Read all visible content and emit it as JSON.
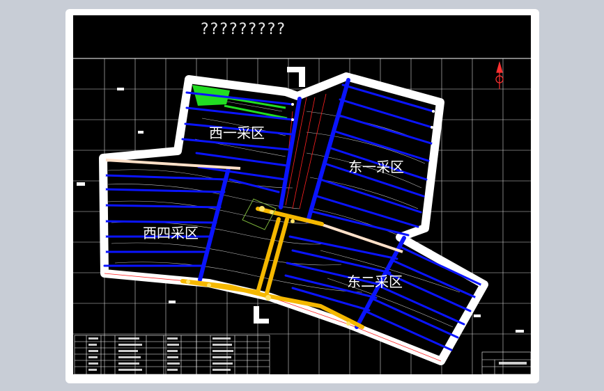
{
  "title": "?????????",
  "zones": {
    "west_one": "西一采区",
    "east_one": "东一采区",
    "west_four": "西四采区",
    "east_two": "东二采区"
  },
  "north_arrow_icon": "north-arrow-icon",
  "colors": {
    "background": "#000000",
    "frame": "#ffffff",
    "haul_road": "#0a14ff",
    "main_roadway": "#f5b800",
    "working_face": "#22dd22",
    "fault_line": "#ff2020",
    "contour": "#ffffff"
  },
  "legend_table": {
    "rows": 6,
    "columns": 16
  }
}
